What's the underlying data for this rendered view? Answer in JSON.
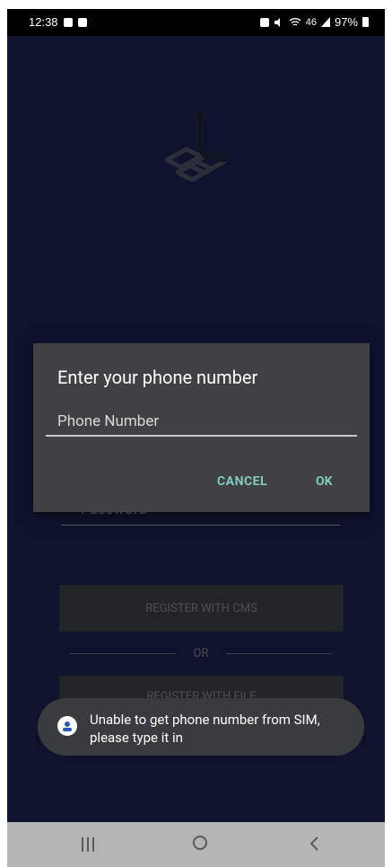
{
  "status_bar": {
    "time": "12:38",
    "network_text": "46",
    "battery": "97%"
  },
  "background_form": {
    "password_placeholder": "Password",
    "register_cms_label": "REGISTER WITH CMS",
    "or_label": "OR",
    "register_file_label": "REGISTER WITH FILE"
  },
  "dialog": {
    "title": "Enter your phone number",
    "input_placeholder": "Phone Number",
    "cancel_label": "CANCEL",
    "ok_label": "OK"
  },
  "toast": {
    "message": "Unable to get phone number from SIM, please type it in"
  },
  "colors": {
    "app_background": "#1a2151",
    "dialog_background": "#414042",
    "accent": "#80cbc4"
  },
  "icons": {
    "app_logo": "upload-boxes-logo",
    "status_left": [
      "shield-icon",
      "checkbox-icon"
    ],
    "status_right": [
      "alarm-icon",
      "mute-icon",
      "wifi-icon",
      "signal-icon",
      "battery-icon"
    ],
    "nav": [
      "recents-icon",
      "home-icon",
      "back-icon"
    ]
  }
}
